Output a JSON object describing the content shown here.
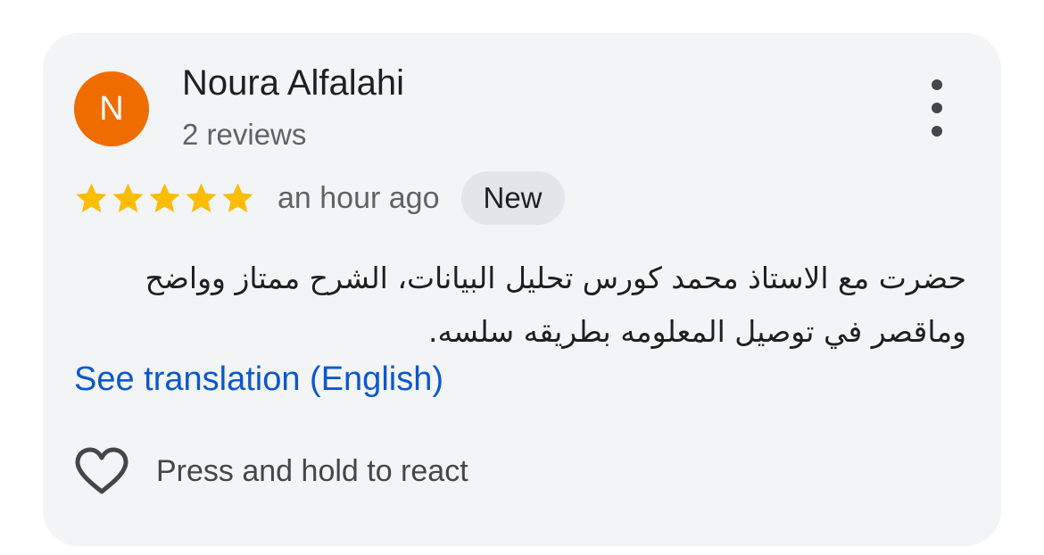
{
  "review": {
    "author": {
      "initial": "N",
      "name": "Noura Alfalahi",
      "reviews_count": "2 reviews",
      "avatar_color": "#ef6c00"
    },
    "menu_icon": "more-vert-icon",
    "rating": 5,
    "rating_max": 5,
    "star_color": "#fbbc04",
    "time_ago": "an hour ago",
    "badge": "New",
    "text": "حضرت مع الاستاذ محمد كورس تحليل البيانات، الشرح ممتاز وواضح وماقصر في توصيل المعلومه بطريقه سلسه.",
    "translation_link": "See translation (English)",
    "link_color": "#0b57d0",
    "react": {
      "icon": "heart-outline-icon",
      "label": "Press and hold to react"
    }
  }
}
